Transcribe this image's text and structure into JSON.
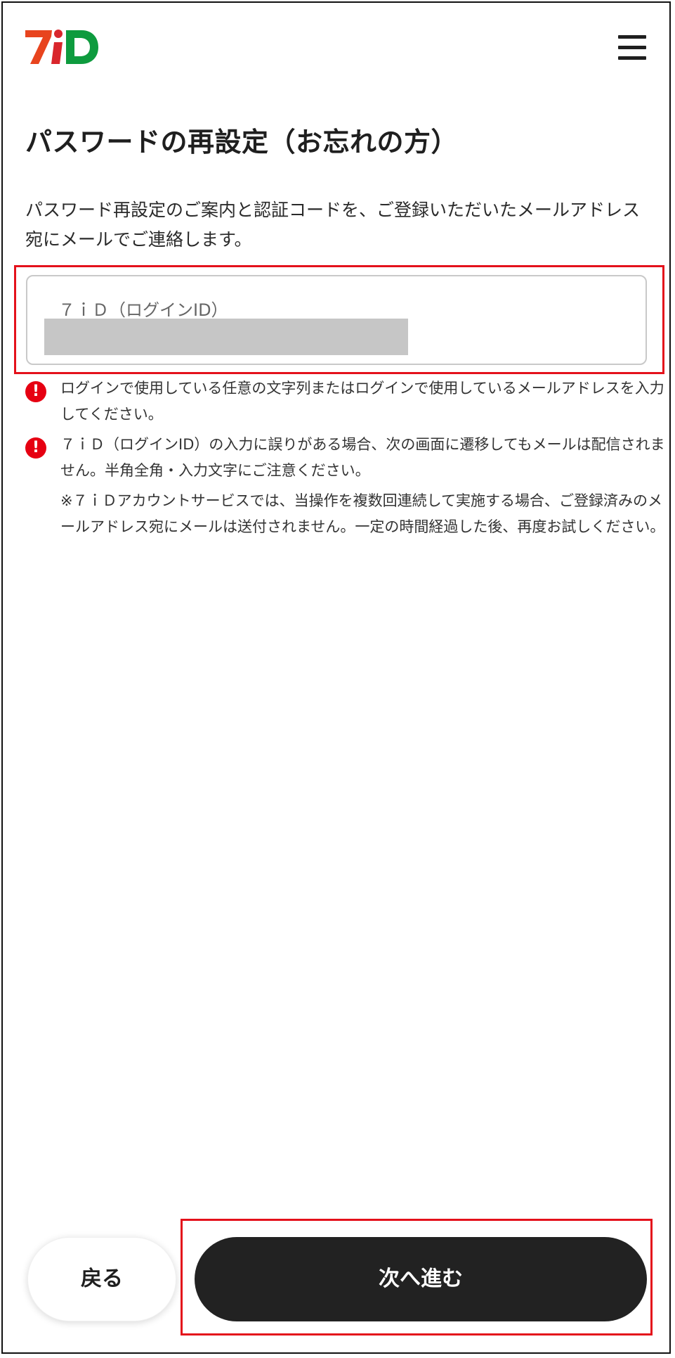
{
  "header": {
    "logo_text": "7iD",
    "logo_colors": [
      "#e8441e",
      "#0e9b3e"
    ],
    "menu_icon": "hamburger-menu-icon"
  },
  "main": {
    "title": "パスワードの再設定（お忘れの方）",
    "intro": "パスワード再設定のご案内と認証コードを、ご登録いただいたメールアドレス宛にメールでご連絡します。",
    "input": {
      "label": "７ｉＤ（ログインID）",
      "value": ""
    },
    "notes": [
      {
        "icon": "alert-icon",
        "text": "ログインで使用している任意の文字列またはログインで使用しているメールアドレスを入力してください。"
      },
      {
        "icon": "alert-icon",
        "text": "７ｉＤ（ログインID）の入力に誤りがある場合、次の画面に遷移してもメールは配信されません。半角全角・入力文字にご注意ください。"
      },
      {
        "icon": "",
        "text": "※７ｉＤアカウントサービスでは、当操作を複数回連続して実施する場合、ご登録済みのメールアドレス宛にメールは送付されません。一定の時間経過した後、再度お試しください。"
      }
    ]
  },
  "footer": {
    "back_label": "戻る",
    "next_label": "次へ進む"
  },
  "colors": {
    "alert": "#e60012",
    "highlight": "#e4111b",
    "primary_button": "#222222"
  }
}
